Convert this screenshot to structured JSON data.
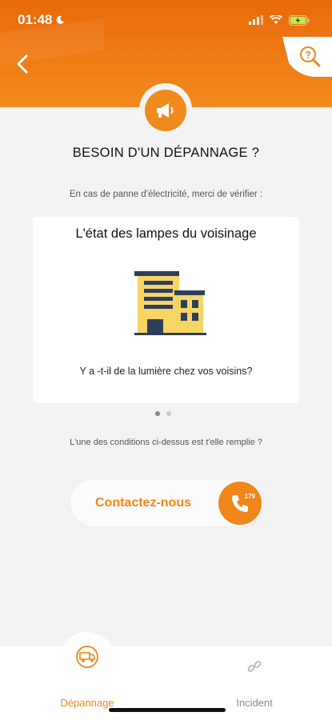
{
  "status_bar": {
    "time": "01:48"
  },
  "header": {
    "back_icon": "chevron-left-icon",
    "help_icon": "search-question-icon"
  },
  "page": {
    "badge_icon": "megaphone-icon",
    "title": "BESOIN D'UN DÉPANNAGE ?",
    "subtitle": "En cas de panne d'électricité, merci de vérifier :"
  },
  "card": {
    "title": "L'état des lampes du voisinage",
    "illustration": "building-icon",
    "question": "Y a -t-il de la lumière chez vos voisins?"
  },
  "carousel": {
    "pages": 2,
    "active": 1
  },
  "condition_text": "L'une des conditions ci-dessus est t'elle  remplie ?",
  "contact": {
    "label": "Contactez-nous",
    "phone_number": "179",
    "icon": "phone-icon"
  },
  "tabs": [
    {
      "label": "Dépannage",
      "icon": "truck-icon",
      "active": true
    },
    {
      "label": "Incident",
      "icon": "broken-link-icon",
      "active": false
    }
  ],
  "colors": {
    "accent": "#f0861a",
    "header_top": "#e96a0a",
    "background": "#f3f3f3"
  }
}
